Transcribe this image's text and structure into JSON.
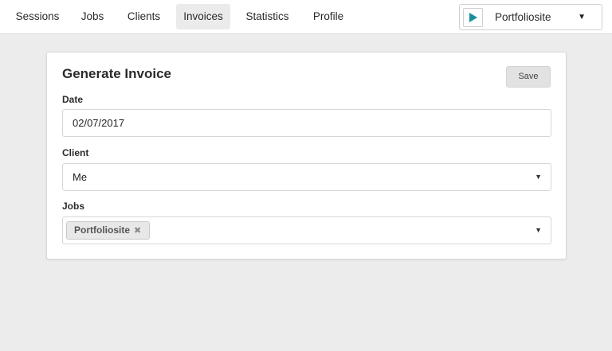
{
  "nav": {
    "items": [
      {
        "label": "Sessions",
        "active": false
      },
      {
        "label": "Jobs",
        "active": false
      },
      {
        "label": "Clients",
        "active": false
      },
      {
        "label": "Invoices",
        "active": true
      },
      {
        "label": "Statistics",
        "active": false
      },
      {
        "label": "Profile",
        "active": false
      }
    ],
    "timer": {
      "label": "Portfoliosite",
      "play_icon": "play-icon",
      "caret_icon": "caret-down-icon",
      "accent": "#1b8f9e"
    }
  },
  "form": {
    "title": "Generate Invoice",
    "save_label": "Save",
    "date": {
      "label": "Date",
      "value": "02/07/2017"
    },
    "client": {
      "label": "Client",
      "value": "Me"
    },
    "jobs": {
      "label": "Jobs",
      "tags": [
        "Portfoliosite"
      ],
      "remove_glyph": "✖"
    }
  }
}
